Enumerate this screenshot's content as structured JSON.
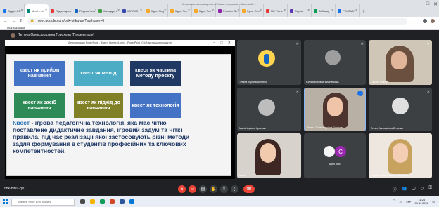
{
  "browser": {
    "window_title": "Встановлені сповіщення (Робоча програма) - Microsoft ...",
    "tabs": [
      {
        "label": "Відділ ОП",
        "color": "#1a73e8",
        "active": false
      },
      {
        "label": "Meet – ol",
        "color": "#00897b",
        "active": true
      },
      {
        "label": "Я дослідник",
        "color": "#e53935",
        "active": false
      },
      {
        "label": "Педагогічна",
        "color": "#1565c0",
        "active": false
      },
      {
        "label": "Кафедра ІІ",
        "color": "#43a047",
        "active": false
      },
      {
        "label": "ІНПОСЗ",
        "color": "#3949ab",
        "active": false
      },
      {
        "label": "Курс: Пед",
        "color": "#f9a825",
        "active": false
      },
      {
        "label": "Курс: Тех",
        "color": "#f9a825",
        "active": false
      },
      {
        "label": "Курс: Тех",
        "color": "#f9a825",
        "active": false
      },
      {
        "label": "Practice Su",
        "color": "#8e24aa",
        "active": false
      },
      {
        "label": "Курс: Осн",
        "color": "#f9a825",
        "active": false
      },
      {
        "label": "ПС Рівне",
        "color": "#e53935",
        "active": false
      },
      {
        "label": "Сервіс",
        "color": "#5e35b1",
        "active": false
      },
      {
        "label": "Таблиці",
        "color": "#0f9d58",
        "active": false
      },
      {
        "label": "РЕКОМЕ",
        "color": "#1a73e8",
        "active": false
      }
    ],
    "url": "meet.google.com/onk-bitku-qvi?authuser=0",
    "bookmarks_label": "Інші закладки"
  },
  "meet": {
    "presenter_label": "Тетяна Олександрівна Горохова (Презентація)",
    "meeting_code": "onk-bitku-qvi",
    "participants": [
      {
        "name": "Тетяна Ігорівна Вірченко"
      },
      {
        "name": "Юлія Василівна Вишневська"
      },
      {
        "name": "Оксана Гальчук"
      },
      {
        "name": "Марія Ігорівна Кресова"
      },
      {
        "name": "Тетяна Олександрівна Горохова"
      },
      {
        "name": "Тетяна Миколаївна Вітченко"
      },
      {
        "name": "Марія"
      },
      {
        "name": "Ще 6 осіб"
      },
      {
        "name": "Людмила Миколаївна Омельчко"
      }
    ],
    "others_initial": "С"
  },
  "presentation": {
    "window_title": "Демонстрация PowerPoint - [Квест_Освіта_6.pptx] - PowerPoint (Сбой активации продукта)",
    "boxes": [
      "квест як прийом навчання",
      "квест як метод",
      "квест як частина методу проєкту",
      "квест як засіб навчання",
      "квест як підхід до навчання",
      "квест як технологія"
    ],
    "keyword": "Квест",
    "definition": " - ігрова педагогічна технологія, яка має чітко поставлене дидактичне завдання, ігровий задум та чіткі правила, під час реалізації якої застосовують різні методи задля формування в студентів професійних та ключових компетентностей."
  },
  "taskbar": {
    "search_placeholder": "Введіть текст для пошуку",
    "language": "УКР",
    "time": "11:26",
    "date": "09.11.2022"
  },
  "colors": {
    "meet_bg": "#202124",
    "end_call": "#ea4335",
    "slide_heading": "#1f3864"
  }
}
